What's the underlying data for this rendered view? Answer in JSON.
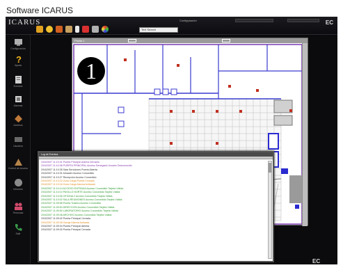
{
  "caption": "Software ICARUS",
  "app": {
    "title": "ICARUS",
    "window_caption": "Configuración",
    "search_placeholder": "Text Search",
    "logo": "EC"
  },
  "toolbar_icons": [
    "building-icon",
    "sun-icon",
    "badge-icon",
    "door-icon",
    "person-icon",
    "camera-icon",
    "monitor-icon",
    "refresh-icon"
  ],
  "sidebar": {
    "items": [
      {
        "icon": "config-icon",
        "label": "Configuración",
        "color": "#b0b0b0"
      },
      {
        "icon": "help-icon",
        "label": "Ayuda",
        "color": "#f2b51c"
      },
      {
        "icon": "events-icon",
        "label": "Eventos",
        "color": "#cfcfcf"
      },
      {
        "icon": "alarms-icon",
        "label": "Alarmas",
        "color": "#cfcfcf"
      },
      {
        "icon": "access-icon",
        "label": "Accesos",
        "color": "#c07a3a"
      },
      {
        "icon": "users-icon",
        "label": "Usuarios",
        "color": "#9a9a9a"
      },
      {
        "icon": "access-control-icon",
        "label": "Control de Acceso",
        "color": "#b5844a"
      },
      {
        "icon": "report-icon",
        "label": "Informes",
        "color": "#8a8a8a"
      },
      {
        "icon": "people-icon",
        "label": "Personas",
        "color": "#d04a6a"
      },
      {
        "icon": "phone-icon",
        "label": "Salir",
        "color": "#3a9a4a"
      }
    ]
  },
  "plan": {
    "title": "Planta 1",
    "badge": "1"
  },
  "log": {
    "title": "Log de Eventos",
    "lines": [
      {
        "text": "2/04/2007 11:10:41 Puerta Principal Alarma Intrusión",
        "color": "#8a3ab0"
      },
      {
        "text": "2/04/2007 11:10:38 PUERTA PRINCIPAL Acceso Denegado Usuario Desconocido",
        "color": "#8a3ab0"
      },
      {
        "text": "2/04/2007 11:10:35 Sala Servidores Puerta Abierta",
        "color": "#333333"
      },
      {
        "text": "2/04/2007 11:10:31 Almacén Acceso Concedido",
        "color": "#333333"
      },
      {
        "text": "2/04/2007 11:10:27 Recepción Acceso Concedido",
        "color": "#333333"
      },
      {
        "text": "2/04/2007 11:10:22 Zona Carga Puerta Forzada",
        "color": "#e08a1a"
      },
      {
        "text": "2/04/2007 11:10:18 Zona Carga Alarma Activada",
        "color": "#e08a1a"
      },
      {
        "text": "2/04/2007 11:10:14 ACCESO ENTRADA Acceso Concedido Tarjeta Válida",
        "color": "#2f9a2f"
      },
      {
        "text": "2/04/2007 11:10:10 PASILLO NORTE Acceso Concedido Tarjeta Válida",
        "color": "#2f9a2f"
      },
      {
        "text": "2/04/2007 11:10:06 OFICINA 2 Acceso Concedido Tarjeta Válida",
        "color": "#2f9a2f"
      },
      {
        "text": "2/04/2007 11:10:02 SALA REUNIONES Acceso Concedido Tarjeta Válida",
        "color": "#2f9a2f"
      },
      {
        "text": "2/04/2007 11:09:58 Puerta Trasera Acceso Concedido",
        "color": "#2f9a2f"
      },
      {
        "text": "2/04/2007 11:09:54 DIRECCIÓN Acceso Concedido Tarjeta Válida",
        "color": "#2f9a2f"
      },
      {
        "text": "2/04/2007 11:09:50 LABORATORIO Acceso Concedido Tarjeta Válida",
        "color": "#2f9a2f"
      },
      {
        "text": "2/04/2007 11:09:46 ARCHIVO Acceso Concedido Tarjeta Válida",
        "color": "#2f9a2f"
      },
      {
        "text": "2/04/2007 11:09:42 Puerta Principal Cerrada",
        "color": "#333333"
      },
      {
        "text": "2/04/2007 11:09:38 Garaje Alarma Activada",
        "color": "#e08a1a"
      },
      {
        "text": "2/04/2007 11:09:34 Puerta Principal Abierta",
        "color": "#333333"
      },
      {
        "text": "2/04/2007 11:09:30 Puerta Principal Cerrada",
        "color": "#333333"
      }
    ]
  }
}
